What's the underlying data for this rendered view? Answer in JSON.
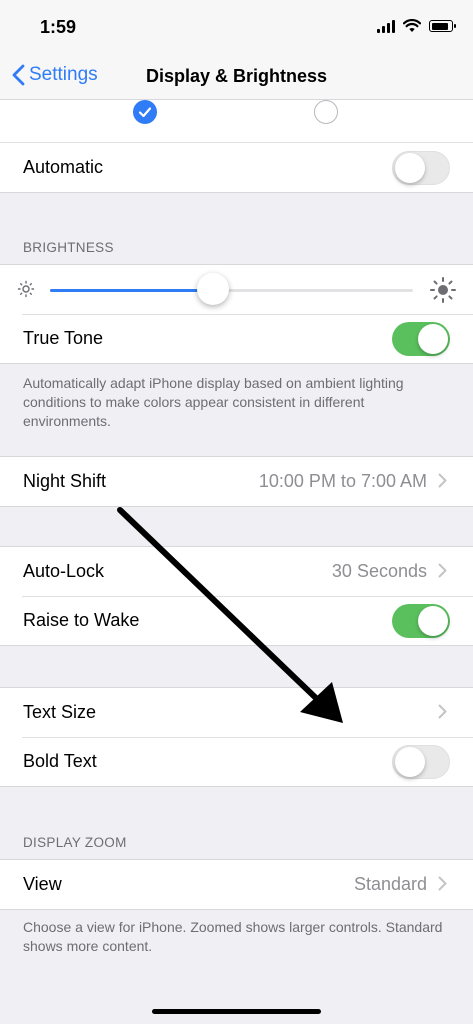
{
  "status_bar": {
    "time": "1:59",
    "battery_level": 0.9
  },
  "nav": {
    "back_label": "Settings",
    "title": "Display & Brightness"
  },
  "appearance": {
    "selected": "light"
  },
  "automatic": {
    "label": "Automatic",
    "on": false
  },
  "brightness": {
    "header": "BRIGHTNESS",
    "level": 0.45
  },
  "true_tone": {
    "label": "True Tone",
    "on": true,
    "footnote": "Automatically adapt iPhone display based on ambient lighting conditions to make colors appear consistent in different environments."
  },
  "night_shift": {
    "label": "Night Shift",
    "value": "10:00 PM to 7:00 AM"
  },
  "auto_lock": {
    "label": "Auto-Lock",
    "value": "30 Seconds"
  },
  "raise_to_wake": {
    "label": "Raise to Wake",
    "on": true
  },
  "text_size": {
    "label": "Text Size"
  },
  "bold_text": {
    "label": "Bold Text",
    "on": false
  },
  "display_zoom": {
    "header": "DISPLAY ZOOM",
    "view_label": "View",
    "view_value": "Standard",
    "footnote": "Choose a view for iPhone. Zoomed shows larger controls. Standard shows more content."
  },
  "colors": {
    "accent": "#2f7cf6",
    "toggle_on": "#5ac05e"
  }
}
